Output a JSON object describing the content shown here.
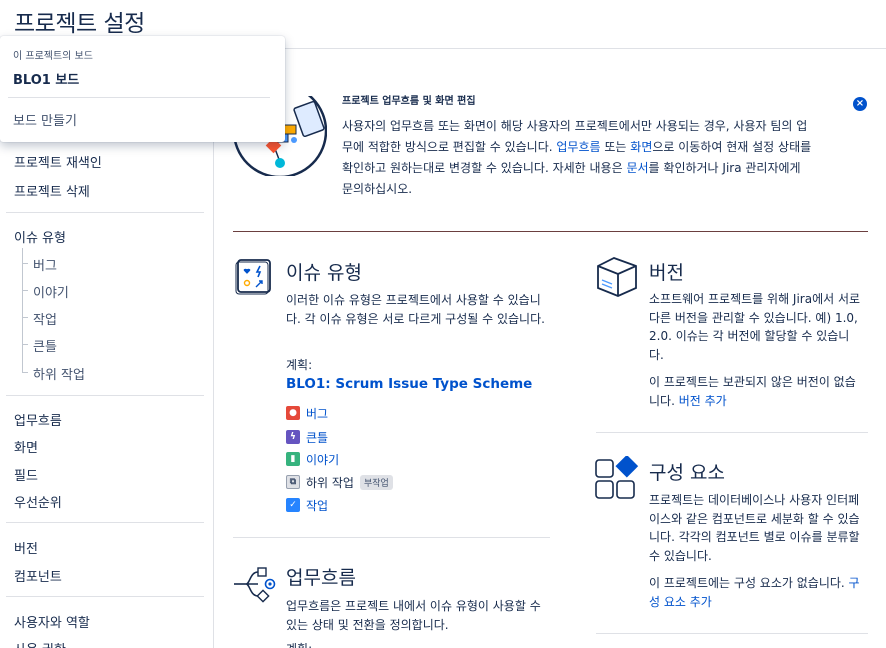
{
  "page": {
    "title": "프로젝트 설정"
  },
  "popup": {
    "heading": "이 프로젝트의 보드",
    "board": "BLO1 보드",
    "create": "보드 만들기"
  },
  "sidebar": {
    "group1": [
      "프로젝트 재색인",
      "프로젝트 삭제"
    ],
    "issue_types": "이슈 유형",
    "issue_type_children": [
      "버그",
      "이야기",
      "작업",
      "큰틀",
      "하위 작업"
    ],
    "group3": [
      "업무흐름",
      "화면",
      "필드",
      "우선순위"
    ],
    "group4": [
      "버전",
      "컴포넌트"
    ],
    "group5": [
      "사용자와 역할",
      "사용 권한"
    ]
  },
  "banner": {
    "title": "프로젝트 업무흐름 및 화면 편집",
    "text_a": "사용자의 업무흐름 또는 화면이 해당 사용자의 프로젝트에서만 사용되는 경우, 사용자 팀의 업무에 적합한 방식으로 편집할 수 있습니다. ",
    "link1": "업무흐름",
    "text_b": " 또는 ",
    "link2": "화면",
    "text_c": "으로 이동하여 현재 설정 상태를 확인하고 원하는대로 변경할 수 있습니다. 자세한 내용은 ",
    "link3": "문서",
    "text_d": "를 확인하거나 Jira 관리자에게 문의하십시오.",
    "close_label": "×"
  },
  "issue_types_card": {
    "title": "이슈 유형",
    "description": "이러한 이슈 유형은 프로젝트에서 사용할 수 있습니다. 각 이슈 유형은 서로 다르게 구성될 수 있습니다.",
    "scheme_label": "계획:",
    "scheme_name": "BLO1: Scrum Issue Type Scheme",
    "items": [
      {
        "label": "버그",
        "color": "#e5493a",
        "glyph": "●"
      },
      {
        "label": "큰틀",
        "color": "#6554c0",
        "glyph": "ϟ"
      },
      {
        "label": "이야기",
        "color": "#36b37e",
        "glyph": "▮"
      },
      {
        "label": "하위 작업",
        "color": "#dfe1e6",
        "glyph": "⧉",
        "badge": "부작업"
      },
      {
        "label": "작업",
        "color": "#2684ff",
        "glyph": "✓"
      }
    ]
  },
  "workflow_card": {
    "title": "업무흐름",
    "description": "업무흐름은 프로젝트 내에서 이슈 유형이 사용할 수 있는 상태 및 전환을 정의합니다.",
    "scheme_label": "계획:"
  },
  "versions_card": {
    "title": "버전",
    "description": "소프트웨어 프로젝트를 위해 Jira에서 서로 다른 버전을 관리할 수 있습니다. 예) 1.0, 2.0. 이슈는 각 버전에 할당할 수 있습니다.",
    "empty_text": "이 프로젝트는 보관되지 않은 버전이 없습니다. ",
    "add_link": "버전 추가"
  },
  "components_card": {
    "title": "구성 요소",
    "description": "프로젝트는 데이터베이스나 사용자 인터페이스와 같은 컴포넌트로 세분화 할 수 있습니다. 각각의 컴포넌트 별로 이슈를 분류할 수 있습니다.",
    "empty_text": "이 프로젝트에는 구성 요소가 없습니다. ",
    "add_link": "구성 요소 추가"
  }
}
